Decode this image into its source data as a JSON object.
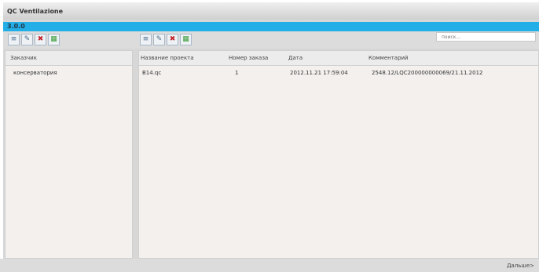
{
  "app": {
    "title": "QC Ventilazione",
    "version": "3.0.0"
  },
  "colors": {
    "accent": "#22aee6",
    "delete": "#c0202a",
    "excel": "#3a9c3a"
  },
  "left_toolbar": [
    {
      "icon": "list-icon",
      "glyph": "≡"
    },
    {
      "icon": "edit-icon",
      "glyph": "✎"
    },
    {
      "icon": "delete-icon",
      "glyph": "✖"
    },
    {
      "icon": "excel-icon",
      "glyph": "▦"
    }
  ],
  "right_toolbar": [
    {
      "icon": "list-icon",
      "glyph": "≡"
    },
    {
      "icon": "edit-icon",
      "glyph": "✎"
    },
    {
      "icon": "delete-icon",
      "glyph": "✖"
    },
    {
      "icon": "excel-icon",
      "glyph": "▦"
    }
  ],
  "search": {
    "placeholder": "поиск..."
  },
  "clients_table": {
    "header": "Заказчик",
    "rows": [
      "консерватория"
    ]
  },
  "projects_table": {
    "headers": [
      "Название проекта",
      "Номер заказа",
      "Дата",
      "Комментарий"
    ],
    "rows": [
      [
        "B14.qc",
        "1",
        "2012.11.21 17:59:04",
        "2548.12/LQC200000000069/21.11.2012"
      ]
    ]
  },
  "footer": {
    "next_label": "Дальше>"
  }
}
